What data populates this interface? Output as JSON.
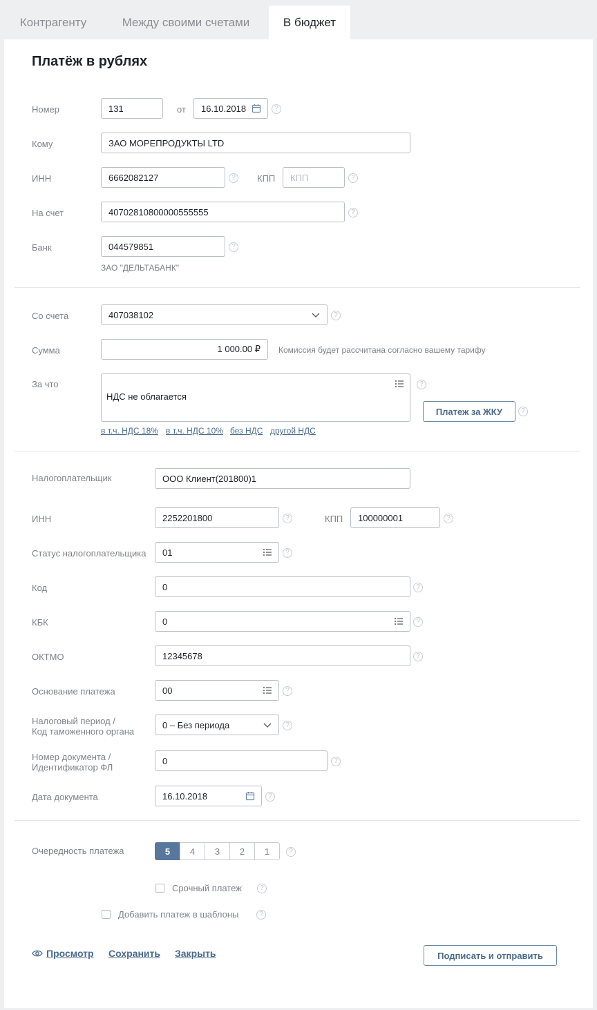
{
  "tabs": [
    "Контрагенту",
    "Между своими счетами",
    "В бюджет"
  ],
  "title": "Платёж в рублях",
  "recipient": {
    "number_label": "Номер",
    "number_value": "131",
    "from_label": "от",
    "date_value": "16.10.2018",
    "to_label": "Кому",
    "to_value": "ЗАО МОРЕПРОДУКТЫ LTD",
    "inn_label": "ИНН",
    "inn_value": "6662082127",
    "kpp_label": "КПП",
    "kpp_placeholder": "КПП",
    "account_label": "На счет",
    "account_value": "40702810800000555555",
    "bank_label": "Банк",
    "bank_value": "044579851",
    "bank_name": "ЗАО \"ДЕЛЬТАБАНК\""
  },
  "payment": {
    "from_account_label": "Со счета",
    "from_account_value": "407038102",
    "amount_label": "Сумма",
    "amount_value": "1 000.00 ₽",
    "commission_note": "Комиссия будет рассчитана согласно вашему тарифу",
    "purpose_label": "За что",
    "purpose_value": "НДС не облагается",
    "jku_button": "Платеж за ЖКУ",
    "vat_links": [
      "в т.ч. НДС 18%",
      "в т.ч. НДС 10%",
      "без НДС",
      "другой НДС"
    ]
  },
  "tax": {
    "payer_label": "Налогоплательщик",
    "payer_value": "ООО Клиент(201800)1",
    "inn_label": "ИНН",
    "inn_value": "2252201800",
    "kpp_label": "КПП",
    "kpp_value": "100000001",
    "status_label": "Статус налогоплательщика",
    "status_value": "01",
    "code_label": "Код",
    "code_value": "0",
    "kbk_label": "КБК",
    "kbk_value": "0",
    "oktmo_label": "ОКТМО",
    "oktmo_value": "12345678",
    "basis_label": "Основание платежа",
    "basis_value": "00",
    "period_label_1": "Налоговый период /",
    "period_label_2": "Код таможенного органа",
    "period_value": "0 – Без периода",
    "docnum_label_1": "Номер документа /",
    "docnum_label_2": "Идентификатор ФЛ",
    "docnum_value": "0",
    "docdate_label": "Дата документа",
    "docdate_value": "16.10.2018"
  },
  "priority": {
    "label": "Очередность платежа",
    "options": [
      "5",
      "4",
      "3",
      "2",
      "1"
    ],
    "selected": "5",
    "urgent_label": "Срочный платеж",
    "template_label": "Добавить платеж в шаблоны"
  },
  "actions": {
    "preview": "Просмотр",
    "save": "Сохранить",
    "close": "Закрыть",
    "sign_send": "Подписать и отправить"
  },
  "help_glyph": "?",
  "colors": {
    "accent": "#57779c",
    "link": "#4a6a8c",
    "border": "#b9bec6"
  }
}
